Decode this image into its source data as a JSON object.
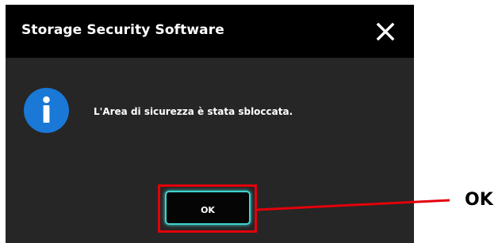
{
  "dialog": {
    "title": "Storage Security Software",
    "close_icon": "close-icon",
    "info_icon": "info-icon",
    "message": "L'Area di sicurezza è stata sbloccata.",
    "ok_label": "OK"
  },
  "annotation": {
    "callout_label": "OK"
  },
  "colors": {
    "titlebar": "#000000",
    "dialog_body": "#262626",
    "info_icon": "#1a78d6",
    "button_glow": "#3fd3cf",
    "highlight": "#e3000b"
  }
}
